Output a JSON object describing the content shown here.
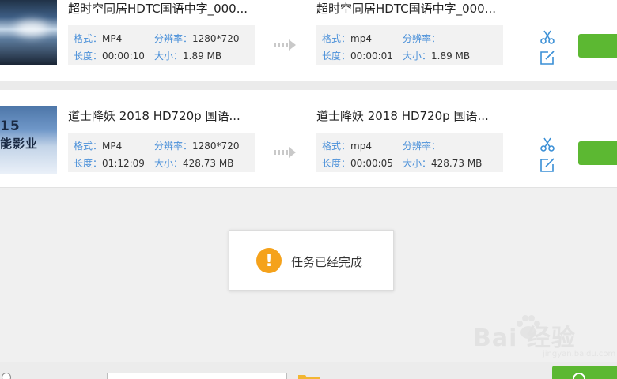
{
  "tasks": [
    {
      "source": {
        "title": "超时空同居HDTC国语中字_000...",
        "format_label": "格式：",
        "format": "MP4",
        "resolution_label": "分辨率：",
        "resolution": "1280*720",
        "duration_label": "长度：",
        "duration": "00:00:10",
        "size_label": "大小：",
        "size": "1.89 MB"
      },
      "output": {
        "title": "超时空同居HDTC国语中字_000...",
        "format_label": "格式：",
        "format": "mp4",
        "resolution_label": "分辨率：",
        "resolution": "",
        "duration_label": "长度：",
        "duration": "00:00:01",
        "size_label": "大小：",
        "size": "1.89 MB"
      }
    },
    {
      "source": {
        "title": "道士降妖 2018 HD720p 国语...",
        "thumb_text_1": "15",
        "thumb_text_2": "能影业",
        "format_label": "格式：",
        "format": "MP4",
        "resolution_label": "分辨率：",
        "resolution": "1280*720",
        "duration_label": "长度：",
        "duration": "01:12:09",
        "size_label": "大小：",
        "size": "428.73 MB"
      },
      "output": {
        "title": "道士降妖 2018 HD720p 国语...",
        "format_label": "格式：",
        "format": "mp4",
        "resolution_label": "分辨率：",
        "resolution": "",
        "duration_label": "长度：",
        "duration": "00:00:05",
        "size_label": "大小：",
        "size": "428.73 MB"
      }
    }
  ],
  "toast": {
    "message": "任务已经完成",
    "icon": "warning-icon"
  },
  "watermark": {
    "text": "Bai 经验",
    "url": "jingyan.baidu.com"
  },
  "colors": {
    "accent_blue": "#4a90d9",
    "green": "#5cb832",
    "warning_orange": "#f5a21b"
  }
}
